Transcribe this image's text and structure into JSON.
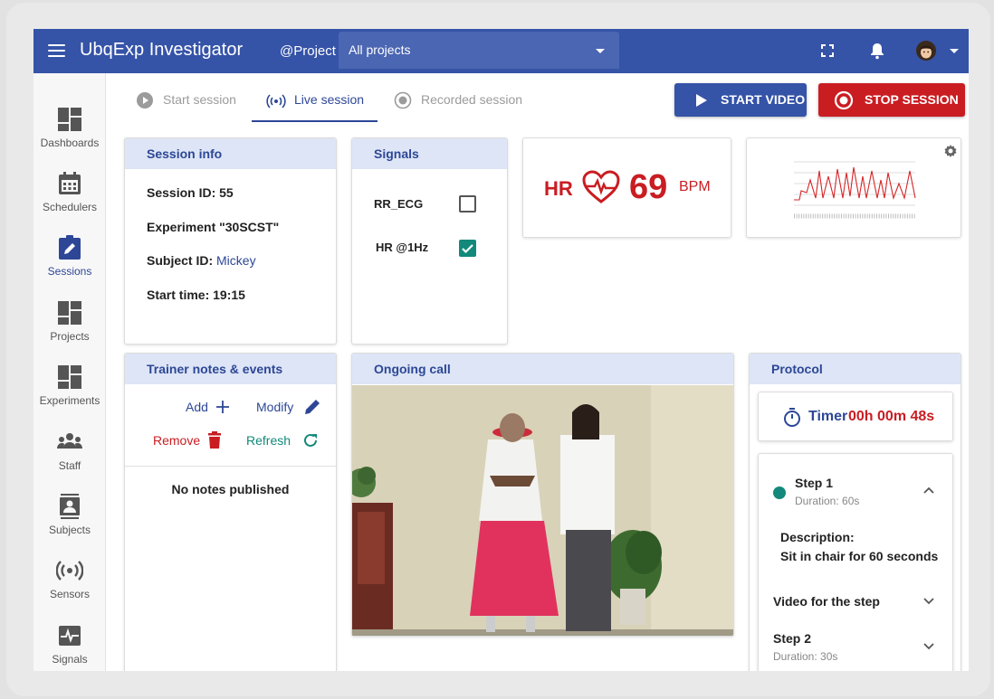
{
  "topbar": {
    "title": "UbqExp Investigator",
    "project_label": "@Project",
    "project_value": "All projects"
  },
  "nav": {
    "items": [
      {
        "label": "Dashboards",
        "icon": "dashboard-icon"
      },
      {
        "label": "Schedulers",
        "icon": "calendar-icon"
      },
      {
        "label": "Sessions",
        "icon": "edit-clipboard-icon"
      },
      {
        "label": "Projects",
        "icon": "dashboard-icon"
      },
      {
        "label": "Experiments",
        "icon": "dashboard-icon"
      },
      {
        "label": "Staff",
        "icon": "people-icon"
      },
      {
        "label": "Subjects",
        "icon": "contact-card-icon"
      },
      {
        "label": "Sensors",
        "icon": "broadcast-icon"
      },
      {
        "label": "Signals",
        "icon": "pulse-icon"
      }
    ]
  },
  "tabs": {
    "start": "Start session",
    "live": "Live session",
    "recorded": "Recorded session"
  },
  "buttons": {
    "start_video": "START VIDEO",
    "stop_session": "STOP SESSION"
  },
  "session_info": {
    "header": "Session info",
    "session_id": "Session ID: 55",
    "experiment": "Experiment \"30SCST\"",
    "subject_label": "Subject ID:",
    "subject_value": "Mickey",
    "start_time": "Start time: 19:15"
  },
  "signals": {
    "header": "Signals",
    "items": [
      {
        "label": "RR_ECG",
        "checked": false
      },
      {
        "label": "HR @1Hz",
        "checked": true
      }
    ]
  },
  "hr": {
    "label": "HR",
    "value": "69",
    "unit": "BPM"
  },
  "notes": {
    "header": "Trainer notes & events",
    "add": "Add",
    "modify": "Modify",
    "remove": "Remove",
    "refresh": "Refresh",
    "empty": "No notes published"
  },
  "call": {
    "header": "Ongoing call"
  },
  "protocol": {
    "header": "Protocol",
    "timer_label": "Timer",
    "timer_value": "00h 00m 48s",
    "step1_title": "Step 1",
    "step1_duration": "Duration: 60s",
    "desc_label": "Description:",
    "desc_text": "Sit in chair for 60 seconds",
    "video_label": "Video for the step",
    "step2_title": "Step 2",
    "step2_duration": "Duration: 30s"
  },
  "colors": {
    "primary": "#3553a7",
    "danger": "#c91d22",
    "teal": "#12897a",
    "card_header": "#dde5f6"
  }
}
